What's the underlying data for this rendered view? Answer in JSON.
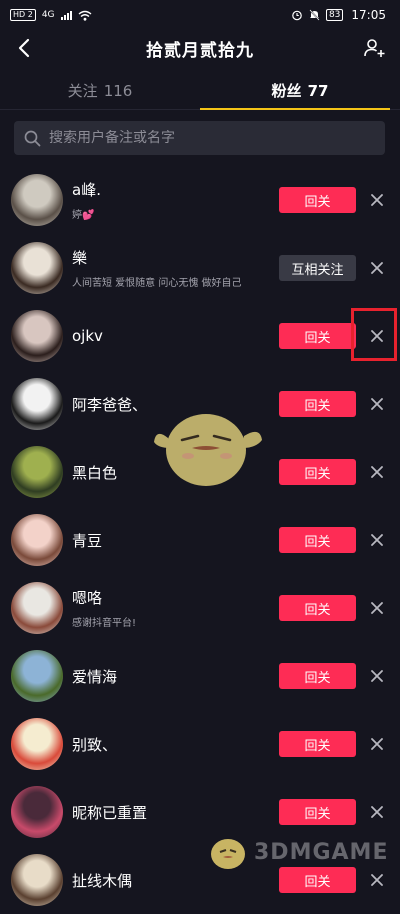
{
  "status_bar": {
    "hd_badge": "HD 2",
    "network": "4G",
    "battery": "83",
    "time": "17:05"
  },
  "header": {
    "title": "拾贰月贰拾九"
  },
  "tabs": [
    {
      "label": "关注",
      "count": "116"
    },
    {
      "label": "粉丝",
      "count": "77"
    }
  ],
  "search": {
    "placeholder": "搜索用户备注或名字"
  },
  "followers": [
    {
      "name": "a峰.",
      "subtitle": "婷💕",
      "button": "回关",
      "avatar_colors": [
        "#cfcac0",
        "#5a5048"
      ]
    },
    {
      "name": "樂",
      "subtitle": "人间苦短 爱恨随意 问心无愧 做好自己",
      "button": "互相关注",
      "avatar_colors": [
        "#e9e1d6",
        "#3a2a22"
      ]
    },
    {
      "name": "ojkv",
      "subtitle": "",
      "button": "回关",
      "avatar_colors": [
        "#d8c6c0",
        "#2b1e1c"
      ]
    },
    {
      "name": "阿李爸爸、",
      "subtitle": "",
      "button": "回关",
      "avatar_colors": [
        "#f2f2f2",
        "#1a1a1a"
      ]
    },
    {
      "name": "黑白色",
      "subtitle": "",
      "button": "回关",
      "avatar_colors": [
        "#9fb04f",
        "#2f3d22"
      ]
    },
    {
      "name": "青豆",
      "subtitle": "",
      "button": "回关",
      "avatar_colors": [
        "#f3d2c9",
        "#7a4a3a"
      ]
    },
    {
      "name": "嗯咯",
      "subtitle": "感谢抖音平台!",
      "button": "回关",
      "avatar_colors": [
        "#e9e7e2",
        "#8a4a3a"
      ]
    },
    {
      "name": "爱情海",
      "subtitle": "",
      "button": "回关",
      "avatar_colors": [
        "#8db3d6",
        "#4a6a2a"
      ]
    },
    {
      "name": "别致、",
      "subtitle": "",
      "button": "回关",
      "avatar_colors": [
        "#f5ecd0",
        "#d94a3a"
      ]
    },
    {
      "name": "昵称已重置",
      "subtitle": "",
      "button": "回关",
      "avatar_colors": [
        "#4a2a3a",
        "#c84a6a"
      ]
    },
    {
      "name": "扯线木偶",
      "subtitle": "",
      "button": "回关",
      "avatar_colors": [
        "#e8dcc8",
        "#5a4030"
      ]
    }
  ],
  "watermark": {
    "text": "3DMGAME"
  },
  "colors": {
    "background": "#15151f",
    "follow_back": "#fe2c55",
    "mutual": "#393a45",
    "tab_indicator": "#f5c518",
    "highlight": "#e8222e"
  }
}
